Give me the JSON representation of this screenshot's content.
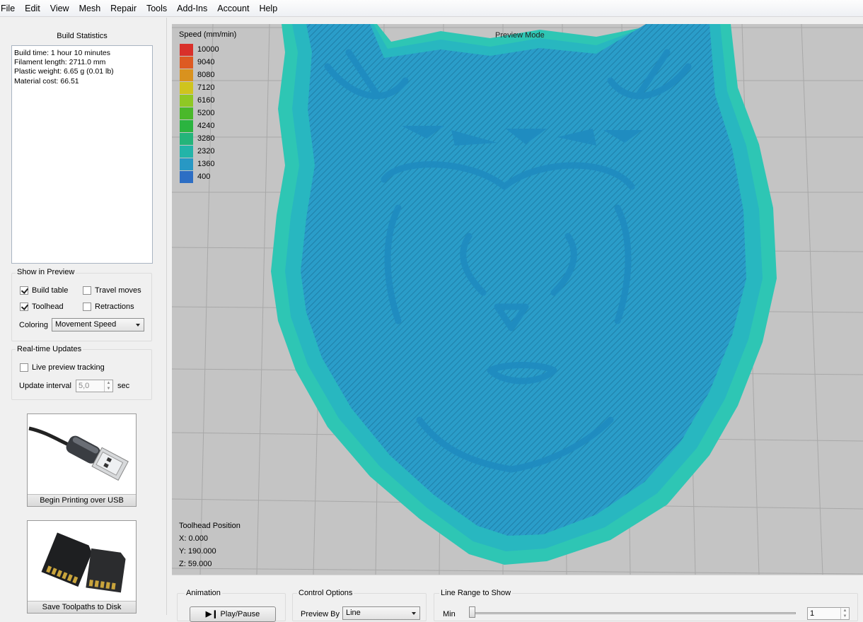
{
  "menu": [
    "File",
    "Edit",
    "View",
    "Mesh",
    "Repair",
    "Tools",
    "Add-Ins",
    "Account",
    "Help"
  ],
  "build_stats": {
    "title": "Build Statistics",
    "lines": [
      "Build time: 1 hour 10 minutes",
      "Filament length: 2711.0 mm",
      "Plastic weight: 6.65 g (0.01 lb)",
      "Material cost: 66.51"
    ]
  },
  "show_in_preview": {
    "title": "Show in Preview",
    "build_table": {
      "label": "Build table",
      "checked": true
    },
    "travel_moves": {
      "label": "Travel moves",
      "checked": false
    },
    "toolhead": {
      "label": "Toolhead",
      "checked": true
    },
    "retractions": {
      "label": "Retractions",
      "checked": false
    },
    "coloring_label": "Coloring",
    "coloring_value": "Movement Speed"
  },
  "realtime": {
    "title": "Real-time Updates",
    "live_preview": {
      "label": "Live preview tracking",
      "checked": false
    },
    "interval_label": "Update interval",
    "interval_value": "5,0",
    "interval_unit": "sec"
  },
  "usb_button": {
    "label": "Begin Printing over USB",
    "icon": "usb-cable-icon"
  },
  "sd_button": {
    "label": "Save Toolpaths to Disk",
    "icon": "sd-card-icon"
  },
  "legend": {
    "title": "Speed (mm/min)",
    "items": [
      {
        "value": "10000",
        "color": "#d9302a"
      },
      {
        "value": "9040",
        "color": "#dd5a22"
      },
      {
        "value": "8080",
        "color": "#d9921e"
      },
      {
        "value": "7120",
        "color": "#cfc41e"
      },
      {
        "value": "6160",
        "color": "#8fc824"
      },
      {
        "value": "5200",
        "color": "#4ab82a"
      },
      {
        "value": "4240",
        "color": "#2bb440"
      },
      {
        "value": "3280",
        "color": "#24b47a"
      },
      {
        "value": "2320",
        "color": "#23b4a8"
      },
      {
        "value": "1360",
        "color": "#2898c4"
      },
      {
        "value": "400",
        "color": "#2d6ec4"
      }
    ]
  },
  "preview_mode": "Preview Mode",
  "toolhead_position": {
    "title": "Toolhead Position",
    "x": "X: 0.000",
    "y": "Y: 190.000",
    "z": "Z: 59.000"
  },
  "bottom": {
    "animation_title": "Animation",
    "play_pause": "Play/Pause",
    "control_title": "Control Options",
    "preview_by_label": "Preview By",
    "preview_by_value": "Line",
    "range_title": "Line Range to Show",
    "min_label": "Min",
    "min_value": "1"
  }
}
